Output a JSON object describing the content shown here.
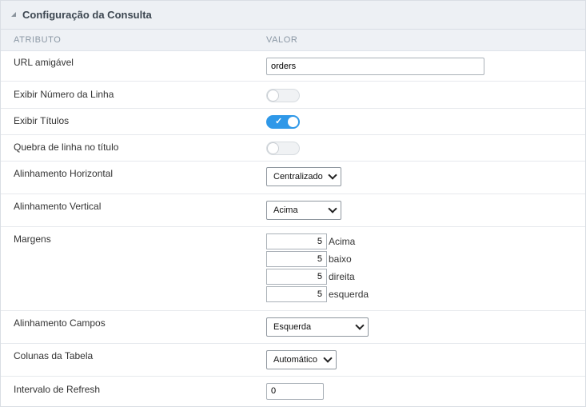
{
  "panel": {
    "title": "Configuração da Consulta"
  },
  "columns": {
    "attribute": "ATRIBUTO",
    "value": "VALOR"
  },
  "fields": {
    "url": {
      "label": "URL amigável",
      "value": "orders"
    },
    "line_number": {
      "label": "Exibir Número da Linha",
      "enabled": false
    },
    "titles": {
      "label": "Exibir Títulos",
      "enabled": true,
      "check": "✓"
    },
    "title_break": {
      "label": "Quebra de linha no título",
      "enabled": false
    },
    "h_align": {
      "label": "Alinhamento Horizontal",
      "value": "Centralizado"
    },
    "v_align": {
      "label": "Alinhamento Vertical",
      "value": "Acima"
    },
    "margins": {
      "label": "Margens",
      "items": [
        {
          "value": "5",
          "label": "Acima"
        },
        {
          "value": "5",
          "label": "baixo"
        },
        {
          "value": "5",
          "label": "direita"
        },
        {
          "value": "5",
          "label": "esquerda"
        }
      ]
    },
    "field_align": {
      "label": "Alinhamento Campos",
      "value": "Esquerda"
    },
    "table_columns": {
      "label": "Colunas da Tabela",
      "value": "Automático"
    },
    "refresh": {
      "label": "Intervalo de Refresh",
      "value": "0"
    }
  },
  "colors": {
    "toggle_on": "#2f98e8",
    "header_bg": "#edf0f4"
  }
}
